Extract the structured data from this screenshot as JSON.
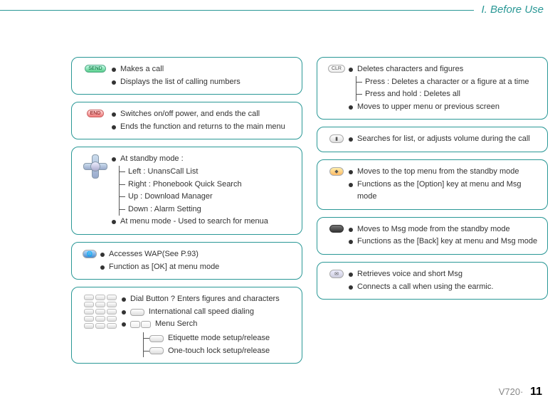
{
  "header": {
    "section_title": "I. Before Use"
  },
  "left_cards": [
    {
      "icon": "send-key",
      "bullets": [
        {
          "text": "Makes a call"
        },
        {
          "text": "Displays the list of calling numbers"
        }
      ]
    },
    {
      "icon": "end-key",
      "bullets": [
        {
          "text": "Switches on/off power, and ends the call"
        },
        {
          "text": "Ends the function and returns to the main menu"
        }
      ]
    },
    {
      "icon": "dpad",
      "bullets": [
        {
          "text": "At standby mode :",
          "branches": [
            "Left : UnansCall List",
            "Right : Phonebook Quick Search",
            "Up : Download Manager",
            "Down : Alarm Setting"
          ]
        },
        {
          "text": "At menu mode - Used to search for menua"
        }
      ]
    },
    {
      "icon": "globe-key",
      "icon_inline": true,
      "bullets": [
        {
          "text": "Accesses WAP(See P.93)"
        },
        {
          "text": "Function as [OK] at menu mode"
        }
      ]
    },
    {
      "icon": "keypad",
      "bullets": [
        {
          "text": "Dial Button ? Enters figures and characters"
        },
        {
          "text": "International call speed dialing",
          "inline_icon": "zero-key"
        },
        {
          "text": "Menu Serch",
          "inline_icon": "split-key",
          "branches_with_icons": [
            {
              "icon": "star-key",
              "label": "Etiquette mode setup/release"
            },
            {
              "icon": "hash-key",
              "label": "One-touch lock setup/release"
            }
          ]
        }
      ]
    }
  ],
  "right_cards": [
    {
      "icon": "clr-key",
      "bullets": [
        {
          "text": "Deletes characters and figures",
          "branches": [
            "Press : Deletes a character or a figure at a time",
            "Press and hold : Deletes all"
          ]
        },
        {
          "text": " Moves to upper menu or previous screen"
        }
      ]
    },
    {
      "icon": "volume-key",
      "bullets": [
        {
          "text": "Searches for list, or adjusts volume during the call"
        }
      ]
    },
    {
      "icon": "prism-key",
      "bullets": [
        {
          "text": "Moves to the top menu from the standby mode"
        },
        {
          "text": "Functions as the [Option] key at menu and Msg mode"
        }
      ]
    },
    {
      "icon": "dark-key",
      "bullets": [
        {
          "text": "Moves to Msg mode from the standby mode"
        },
        {
          "text": "Functions as the [Back] key at menu and Msg mode"
        }
      ]
    },
    {
      "icon": "envelope-key",
      "bullets": [
        {
          "text": "Retrieves voice and short Msg"
        },
        {
          "text": "Connects a call when using the earmic."
        }
      ]
    }
  ],
  "footer": {
    "model": "V720·",
    "page": "11"
  }
}
